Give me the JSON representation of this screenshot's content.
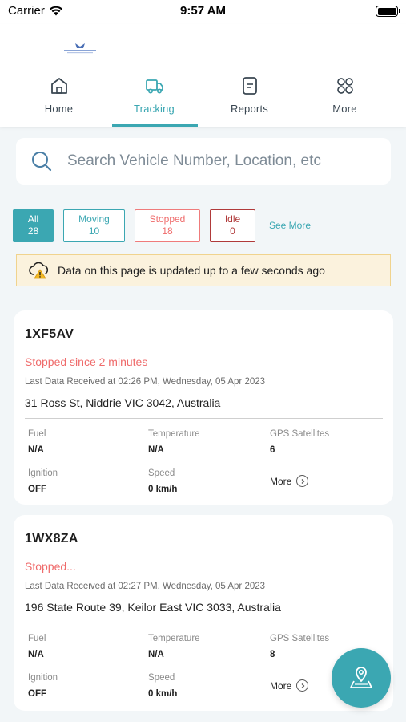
{
  "status_bar": {
    "carrier": "Carrier",
    "time": "9:57 AM"
  },
  "header": {
    "tabs": [
      {
        "label": "Home",
        "icon": "home-icon"
      },
      {
        "label": "Tracking",
        "icon": "truck-icon",
        "active": true
      },
      {
        "label": "Reports",
        "icon": "report-icon"
      },
      {
        "label": "More",
        "icon": "grid-icon"
      }
    ]
  },
  "search": {
    "placeholder": "Search Vehicle Number, Location, etc"
  },
  "filters": {
    "all": {
      "label": "All",
      "count": "28"
    },
    "moving": {
      "label": "Moving",
      "count": "10"
    },
    "stopped": {
      "label": "Stopped",
      "count": "18"
    },
    "idle": {
      "label": "Idle",
      "count": "0"
    },
    "see_more": "See More"
  },
  "notice": {
    "text": "Data on this page is updated up to a few seconds ago"
  },
  "vehicles": [
    {
      "plate": "1XF5AV",
      "status": "Stopped since 2 minutes",
      "last_data": "Last Data Received at 02:26 PM, Wednesday, 05 Apr 2023",
      "address": "31 Ross St, Niddrie VIC 3042, Australia",
      "fuel_label": "Fuel",
      "fuel": "N/A",
      "temp_label": "Temperature",
      "temp": "N/A",
      "gps_label": "GPS Satellites",
      "gps": "6",
      "ignition_label": "Ignition",
      "ignition": "OFF",
      "speed_label": "Speed",
      "speed": "0 km/h",
      "more": "More"
    },
    {
      "plate": "1WX8ZA",
      "status": "Stopped...",
      "last_data": "Last Data Received at 02:27 PM, Wednesday, 05 Apr 2023",
      "address": "196 State Route 39, Keilor East VIC 3033, Australia",
      "fuel_label": "Fuel",
      "fuel": "N/A",
      "temp_label": "Temperature",
      "temp": "N/A",
      "gps_label": "GPS Satellites",
      "gps": "8",
      "ignition_label": "Ignition",
      "ignition": "OFF",
      "speed_label": "Speed",
      "speed": "0 km/h",
      "more": "More"
    }
  ],
  "colors": {
    "accent": "#3ba7b2",
    "stopped": "#ef6b6b",
    "idle": "#b03a3a",
    "notice_bg": "#fbf2dd"
  }
}
